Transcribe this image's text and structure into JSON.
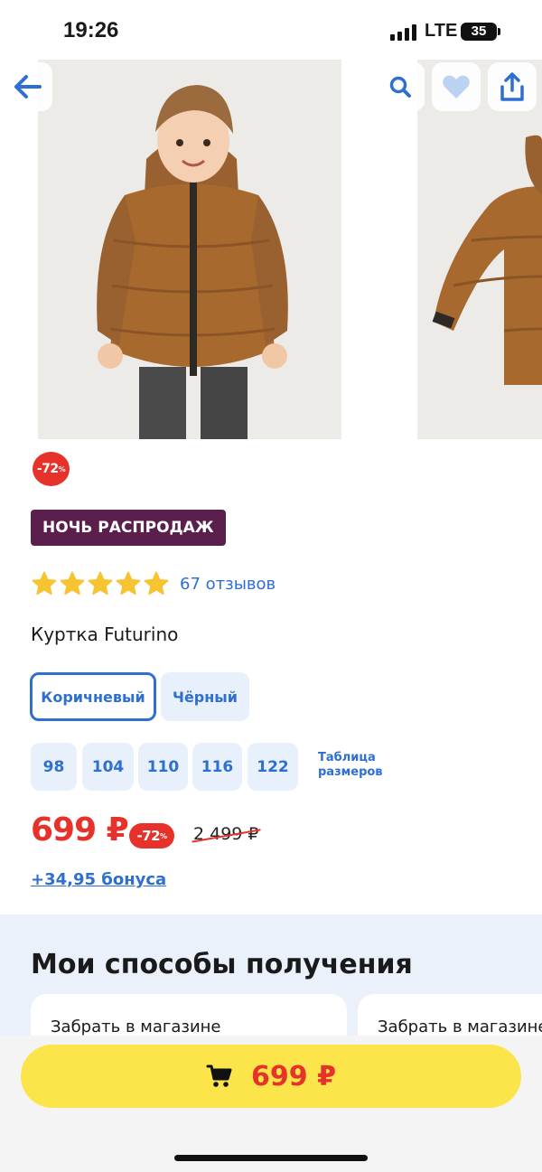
{
  "status_bar": {
    "time": "19:26",
    "network": "LTE",
    "battery": "35"
  },
  "gallery": {
    "main_photo": "boy in brown puffer jacket",
    "next_photo": "brown puffer jacket"
  },
  "header_icons": [
    "back-arrow-icon",
    "search-icon",
    "heart-icon",
    "share-icon"
  ],
  "product": {
    "discount_badge": "-72",
    "discount_unit": "%",
    "sale_label": "НОЧЬ РАСПРОДАЖ",
    "rating_stars": 5,
    "reviews": "67 отзывов",
    "title": "Куртка Futurino",
    "colors": [
      "Коричневый",
      "Чёрный"
    ],
    "selected_color": "Коричневый",
    "sizes": [
      "98",
      "104",
      "110",
      "116",
      "122"
    ],
    "size_chart_line1": "Таблица",
    "size_chart_line2": "размеров",
    "price": "699 ₽",
    "price_discount": "-72",
    "old_price": "2 499 ₽",
    "bonus": "+34,95 бонуса"
  },
  "delivery": {
    "heading": "Мои способы получения",
    "cards": [
      "Забрать в магазине",
      "Забрать в магазине"
    ]
  },
  "cart_button": {
    "price": "699 ₽"
  },
  "colors": {
    "accent_blue": "#2e6fcf",
    "sale_red": "#e6322a",
    "sale_label_bg": "#5b1f4d",
    "cart_yellow": "#fbe54a",
    "star_yellow": "#f7c331"
  }
}
